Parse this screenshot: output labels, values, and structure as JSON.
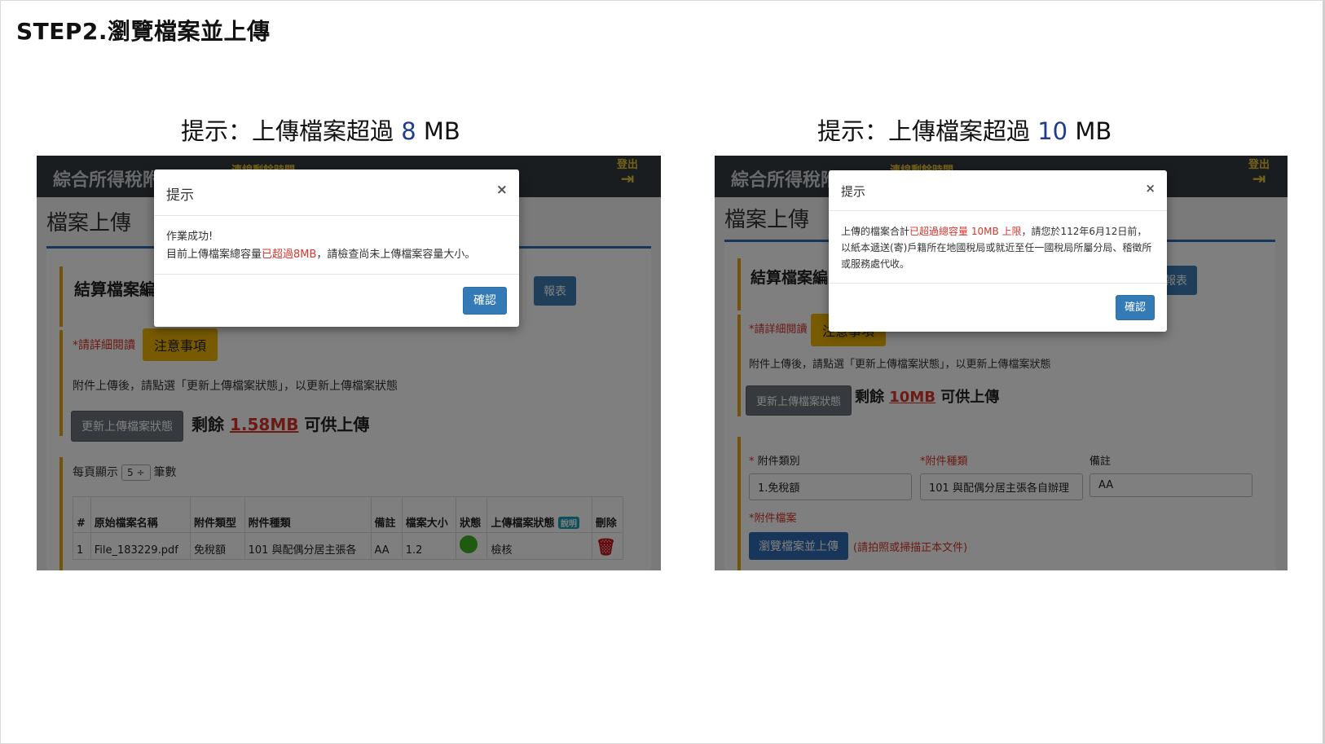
{
  "slide": {
    "step_title": "STEP2.瀏覽檔案並上傳",
    "captions": [
      {
        "prefix": "提示：上傳檔案超過 ",
        "size": "8",
        "unit": " MB"
      },
      {
        "prefix": "提示：上傳檔案超過 ",
        "size": "10",
        "unit": " MB"
      }
    ]
  },
  "app": {
    "title": "綜合所得稅附件上傳",
    "timer_label": "連線剩餘時間",
    "logout_label": "登出",
    "logout_icon": "logout-arrow-icon",
    "page_title": "檔案上傳",
    "section_title": "結算檔案編",
    "side_button_fragment": "報表",
    "read_note": "*請詳細閱讀",
    "notice_button": "注意事項",
    "update_info": "附件上傳後，請點選「更新上傳檔案狀態」，以更新上傳檔案狀態",
    "update_button": "更新上傳檔案狀態",
    "remain_prefix": "剩餘 ",
    "remain_suffix": " 可供上傳"
  },
  "left": {
    "remain_amount": "1.58MB",
    "per_page_prefix": "每頁顯示",
    "per_page_value": "5 ÷",
    "per_page_suffix": "筆數",
    "table": {
      "headers": [
        "#",
        "原始檔案名稱",
        "附件類型",
        "附件種類",
        "備註",
        "檔案大小",
        "狀態",
        "上傳檔案狀態",
        "刪除"
      ],
      "badge": "說明",
      "row": [
        "1",
        "File_183229.pdf",
        "免稅額",
        "101 與配偶分居主張各",
        "AA",
        "1.2",
        "",
        "檢核",
        ""
      ]
    },
    "modal": {
      "title": "提示",
      "close": "×",
      "line1": "作業成功!",
      "line2_prefix": "目前上傳檔案總容量",
      "line2_highlight": "已超過8MB",
      "line2_suffix": "，請檢查尚未上傳檔案容量大小。",
      "ok": "確認"
    }
  },
  "right": {
    "remain_amount": "10MB",
    "form": {
      "type_label": "附件類別",
      "kind_label": "*附件種類",
      "note_label": "備註",
      "type_value": "1.免稅額",
      "kind_value": "101 與配偶分居主張各自辦理",
      "note_value": "AA",
      "file_label": "*附件檔案",
      "browse_button": "瀏覽檔案並上傳",
      "hint": "(請拍照或掃描正本文件)"
    },
    "modal": {
      "title": "提示",
      "close": "×",
      "text_prefix": "上傳的檔案合計",
      "text_highlight": "已超過總容量 10MB 上限",
      "text_suffix": "，請您於112年6月12日前，以紙本遞送(寄)戶籍所在地國稅局或就近至任一國稅局所屬分局、稽徵所或服務處代收。",
      "ok": "確認"
    }
  },
  "colors": {
    "header_bg": "#343a40",
    "accent_yellow": "#e8c233",
    "highlight_red": "#d9342b",
    "primary_blue": "#337ab7",
    "caption_number": "#1f3b8f"
  }
}
